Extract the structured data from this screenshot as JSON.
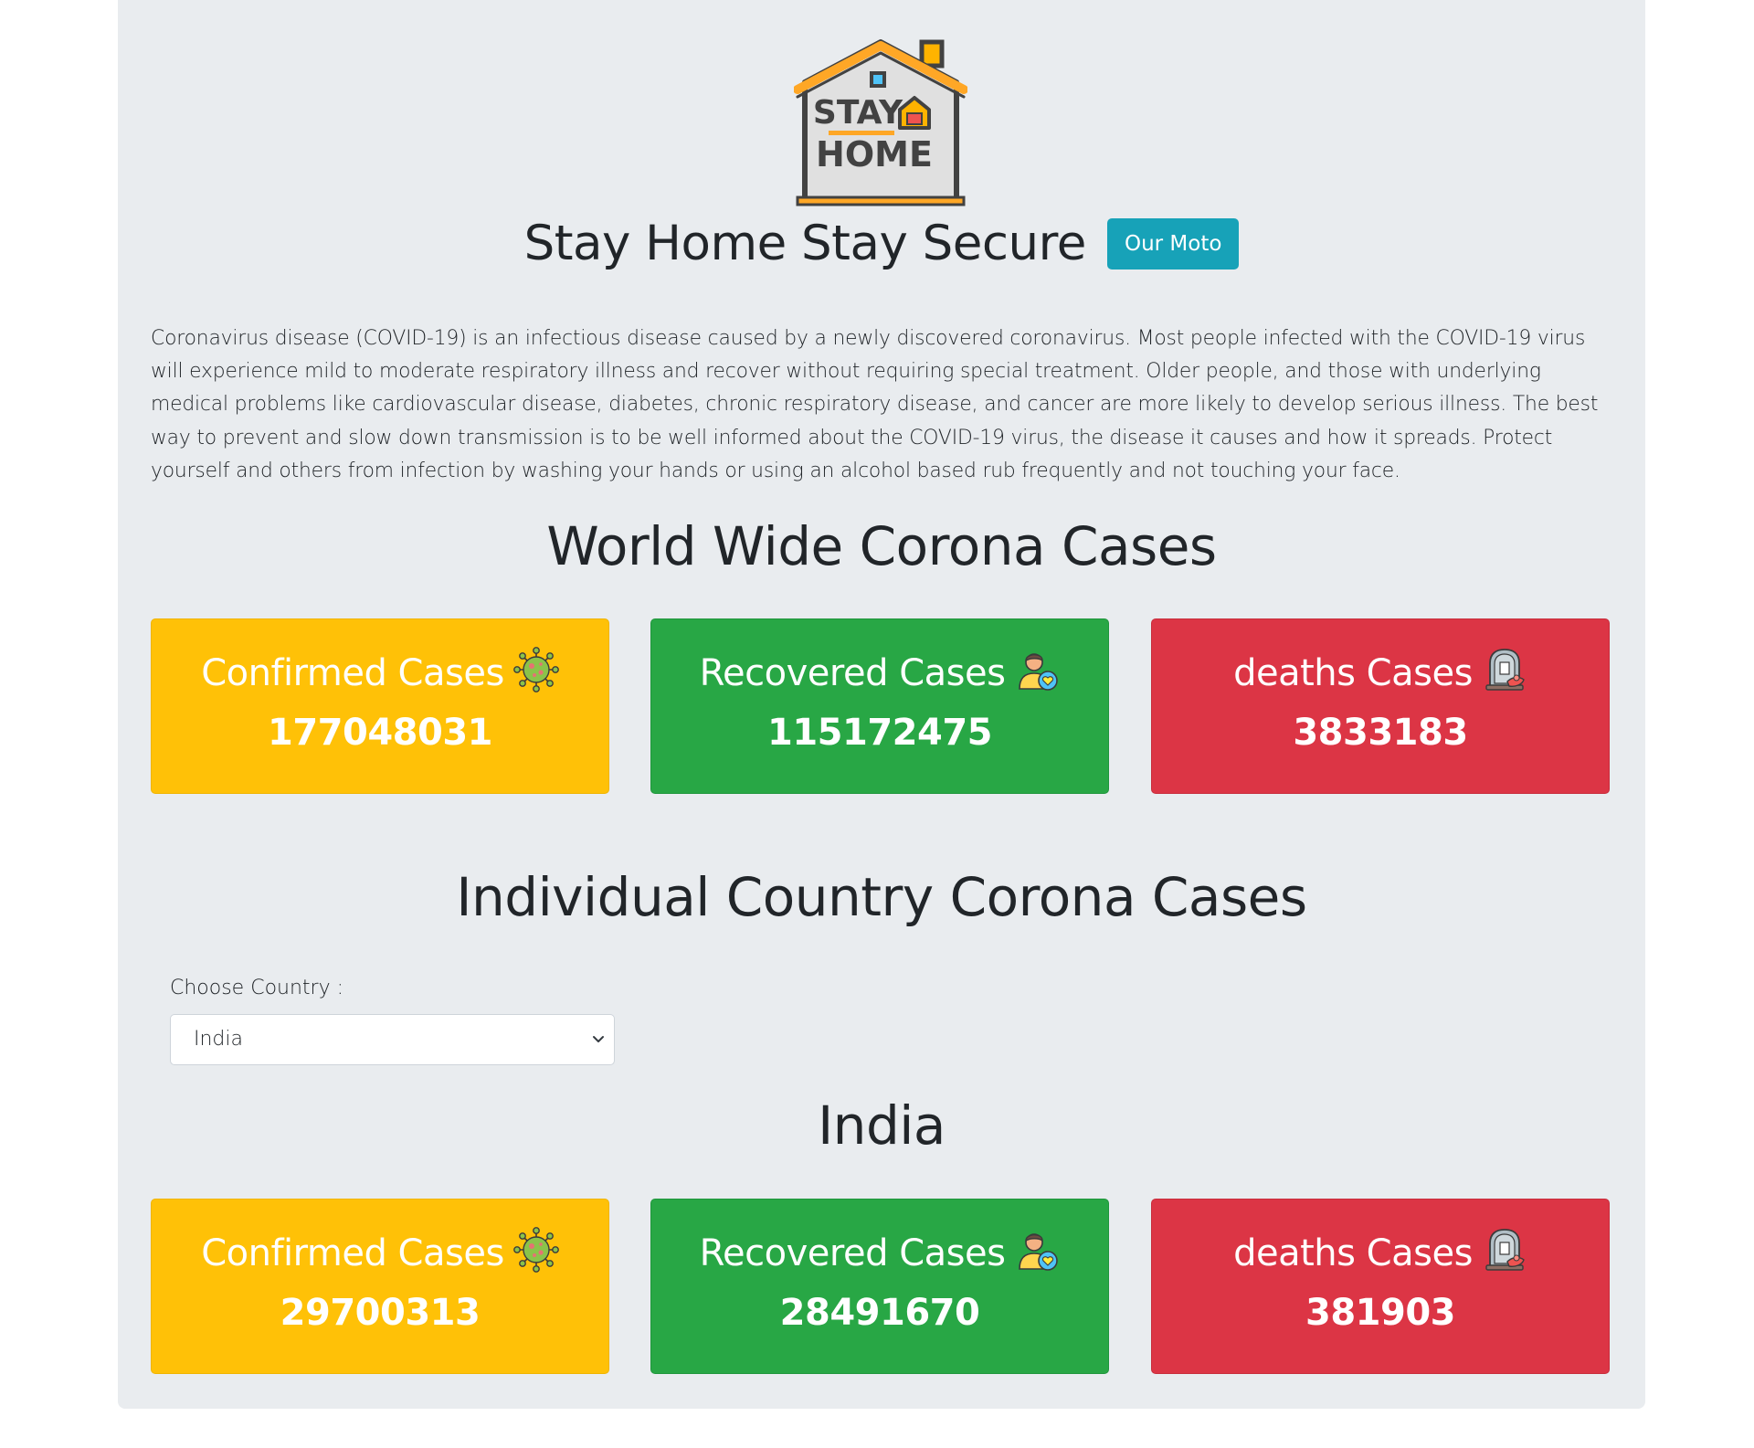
{
  "header": {
    "logo_text_line1": "STAY",
    "logo_text_line2": "HOME",
    "title": "Stay Home Stay Secure",
    "moto_button_label": "Our Moto"
  },
  "intro": {
    "paragraph": "Coronavirus disease (COVID-19) is an infectious disease caused by a newly discovered coronavirus. Most people infected with the COVID-19 virus will experience mild to moderate respiratory illness and recover without requiring special treatment. Older people, and those with underlying medical problems like cardiovascular disease, diabetes, chronic respiratory disease, and cancer are more likely to develop serious illness. The best way to prevent and slow down transmission is to be well informed about the COVID-19 virus, the disease it causes and how it spreads. Protect yourself and others from infection by washing your hands or using an alcohol based rub frequently and not touching your face."
  },
  "world": {
    "heading": "World Wide Corona Cases",
    "cards": [
      {
        "label": "Confirmed Cases",
        "value": "177048031",
        "icon": "virus-icon",
        "color": "#ffc107"
      },
      {
        "label": "Recovered Cases",
        "value": "115172475",
        "icon": "recovered-person-icon",
        "color": "#28a745"
      },
      {
        "label": "deaths Cases",
        "value": "3833183",
        "icon": "gravestone-icon",
        "color": "#dc3545"
      }
    ]
  },
  "country": {
    "heading": "Individual Country Corona Cases",
    "choose_label": "Choose Country :",
    "selected_country": "India",
    "result_heading": "India",
    "cards": [
      {
        "label": "Confirmed Cases",
        "value": "29700313",
        "icon": "virus-icon",
        "color": "#ffc107"
      },
      {
        "label": "Recovered Cases",
        "value": "28491670",
        "icon": "recovered-person-icon",
        "color": "#28a745"
      },
      {
        "label": "deaths Cases",
        "value": "381903",
        "icon": "gravestone-icon",
        "color": "#dc3545"
      }
    ]
  }
}
